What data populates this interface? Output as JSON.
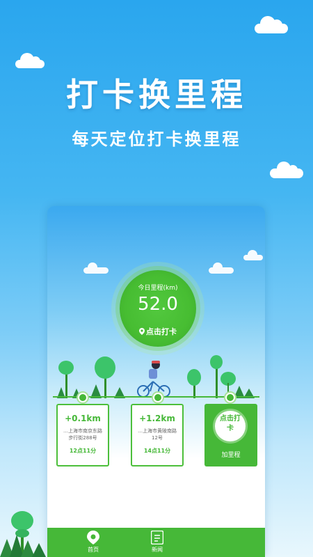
{
  "promo": {
    "headline": "打卡换里程",
    "subline": "每天定位打卡换里程"
  },
  "mileage": {
    "label": "今日里程(km)",
    "value": "52.0",
    "action_label": "点击打卡"
  },
  "checkins": [
    {
      "distance": "+0.1km",
      "address": "…上海市南京东路步行街288号",
      "time": "12点11分"
    },
    {
      "distance": "+1.2km",
      "address": "…上海市黄陂南路12号",
      "time": "14点11分"
    }
  ],
  "checkin_action": {
    "button_label": "点击打卡",
    "caption": "加里程"
  },
  "tabbar": {
    "home_label": "首页",
    "news_label": "新闻"
  },
  "colors": {
    "primary_green": "#46b838",
    "sky_blue": "#2aa6ee"
  },
  "icons": [
    "location-pin-icon",
    "news-icon",
    "bicycle-rider-illustration",
    "tree-illustration"
  ]
}
